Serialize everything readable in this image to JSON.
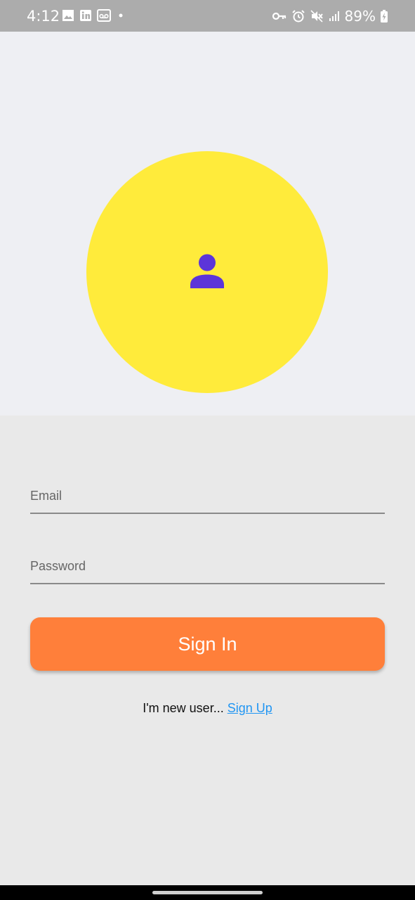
{
  "status_bar": {
    "time": "4:12",
    "battery": "89%",
    "left_icons": [
      "gallery-icon",
      "linkedin-icon",
      "voicemail-icon",
      "notification-dot-icon"
    ],
    "right_icons": [
      "vpn-key-icon",
      "alarm-icon",
      "mute-icon",
      "signal-icon",
      "battery-charging-icon"
    ]
  },
  "hero": {
    "avatar_icon": "person-icon",
    "circle_color": "#ffeb3b",
    "icon_color": "#5c35d9"
  },
  "form": {
    "email_placeholder": "Email",
    "password_placeholder": "Password",
    "signin_label": "Sign In",
    "signin_color": "#ff7f3a",
    "signup_prompt": "I'm new user...",
    "signup_link": "Sign Up",
    "link_color": "#2196f3"
  }
}
